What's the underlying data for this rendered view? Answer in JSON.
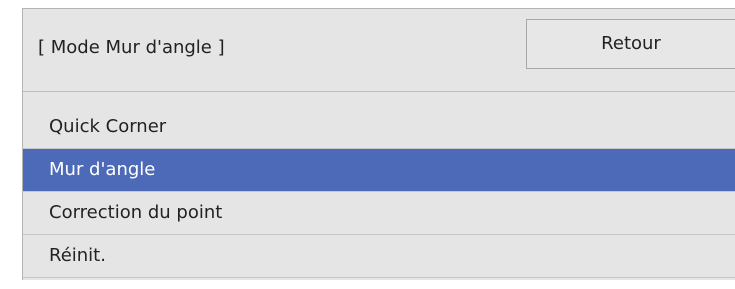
{
  "header": {
    "title": "[ Mode Mur d'angle ]",
    "back_label": "Retour"
  },
  "menu": {
    "items": [
      {
        "label": "Quick Corner",
        "selected": false
      },
      {
        "label": "Mur d'angle",
        "selected": true
      },
      {
        "label": "Correction du point",
        "selected": false
      },
      {
        "label": "Réinit.",
        "selected": false
      }
    ]
  },
  "colors": {
    "selection": "#4d6ab8",
    "panel_background": "#e5e5e5"
  }
}
